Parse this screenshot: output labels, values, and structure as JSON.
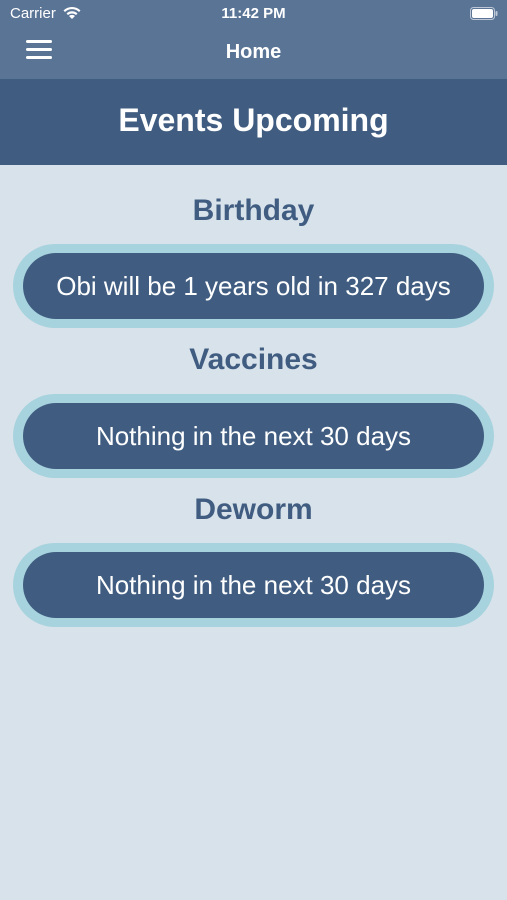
{
  "status_bar": {
    "carrier": "Carrier",
    "time": "11:42 PM"
  },
  "nav": {
    "title": "Home",
    "menu_icon": "hamburger-menu-icon"
  },
  "header": {
    "title": "Events Upcoming"
  },
  "sections": [
    {
      "title": "Birthday",
      "message": "Obi will be 1 years old in 327 days"
    },
    {
      "title": "Vaccines",
      "message": "Nothing in the next 30 days"
    },
    {
      "title": "Deworm",
      "message": "Nothing in the next 30 days"
    }
  ],
  "colors": {
    "nav_bg": "#5a7496",
    "header_bg": "#405d81",
    "page_bg": "#d8e2eb",
    "pill_border": "#a7d3de",
    "pill_fill": "#405d81"
  }
}
